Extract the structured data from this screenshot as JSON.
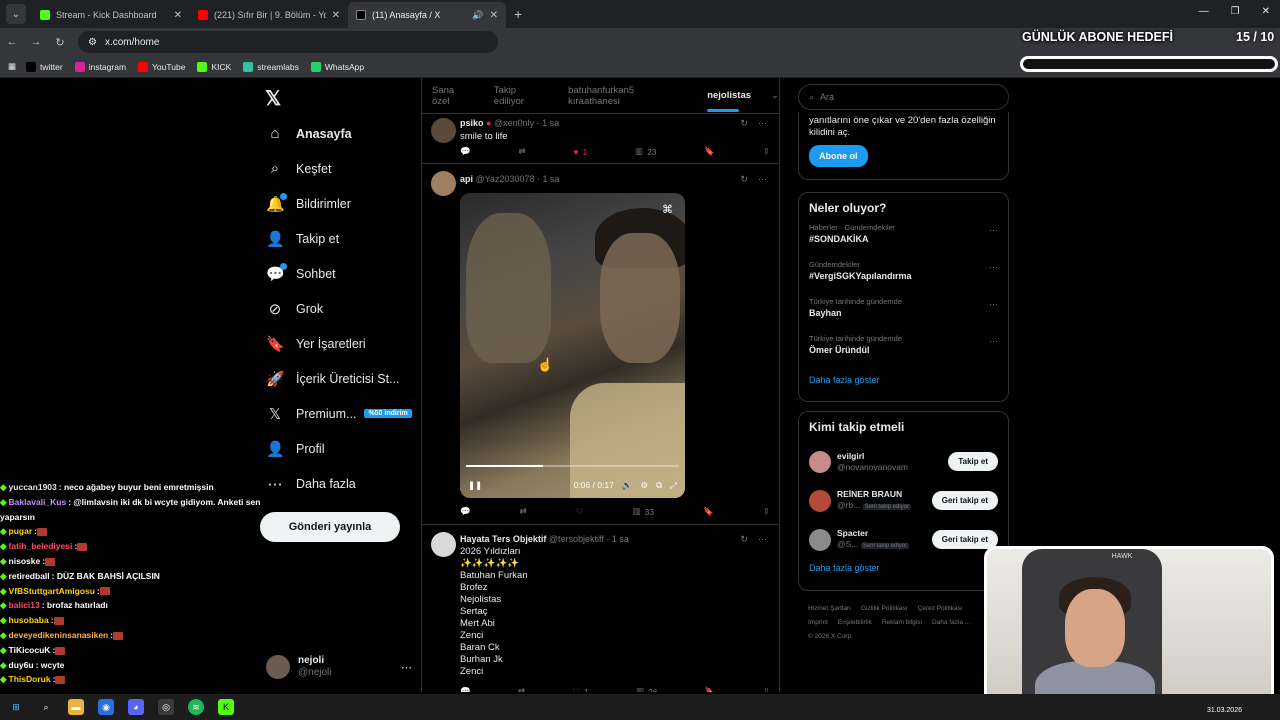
{
  "browser": {
    "tabs": [
      {
        "title": "Stream - Kick Dashboard",
        "color": "#53fc18",
        "active": false
      },
      {
        "title": "(221) Sıfır Bir | 9. Bölüm - YouTu",
        "color": "#ff0000",
        "active": false
      },
      {
        "title": "(11) Anasayfa / X",
        "color": "#000000",
        "active": true
      }
    ],
    "url": "x.com/home",
    "bookmarks": [
      {
        "label": "twitter",
        "icon": "x-icon",
        "color": "#000000"
      },
      {
        "label": "instagram",
        "icon": "instagram-icon",
        "color": "#d6249f"
      },
      {
        "label": "YouTube",
        "icon": "youtube-icon",
        "color": "#ff0000"
      },
      {
        "label": "KICK",
        "icon": "kick-icon",
        "color": "#53fc18"
      },
      {
        "label": "streamlabs",
        "icon": "streamlabs-icon",
        "color": "#31c3a2"
      },
      {
        "label": "WhatsApp",
        "icon": "whatsapp-icon",
        "color": "#25d366"
      }
    ]
  },
  "overlay": {
    "goal_title": "GÜNLÜK ABONE HEDEFİ",
    "goal_count": "15 / 10"
  },
  "nav": {
    "items": [
      {
        "label": "Anasayfa",
        "icon": "home-icon",
        "glyph": "⌂",
        "active": true
      },
      {
        "label": "Keşfet",
        "icon": "search-icon",
        "glyph": "⌕"
      },
      {
        "label": "Bildirimler",
        "icon": "bell-icon",
        "glyph": "🔔",
        "dot": true
      },
      {
        "label": "Takip et",
        "icon": "add-user-icon",
        "glyph": "👤"
      },
      {
        "label": "Sohbet",
        "icon": "chat-icon",
        "glyph": "💬",
        "dot": true
      },
      {
        "label": "Grok",
        "icon": "grok-icon",
        "glyph": "⊘"
      },
      {
        "label": "Yer İşaretleri",
        "icon": "bookmark-icon",
        "glyph": "🔖"
      },
      {
        "label": "İçerik Üreticisi St...",
        "icon": "rocket-icon",
        "glyph": "🚀"
      },
      {
        "label": "Premium...",
        "icon": "x-premium-icon",
        "glyph": "𝕏",
        "badge": "%50 indirim"
      },
      {
        "label": "Profil",
        "icon": "profile-icon",
        "glyph": "👤"
      },
      {
        "label": "Daha fazla",
        "icon": "more-icon",
        "glyph": "⋯"
      }
    ],
    "post_button": "Gönderi yayınla",
    "account": {
      "name": "nejoli",
      "handle": "@nejoli"
    }
  },
  "chat": [
    {
      "user": "yuccan1903",
      "color": "#e6e6e6",
      "msg": ": neco ağabey buyur beni emretmişsin"
    },
    {
      "user": "Baklavali_Kus",
      "color": "#c68cff",
      "msg": ": @limlavsin iki dk bi wcyte gidiyom. Anketi sen"
    },
    {
      "user": "",
      "color": "#ffffff",
      "msg": "yaparsın"
    },
    {
      "user": "pugar",
      "color": "#ffd400",
      "msg": ":"
    },
    {
      "user": "fatih_belediyesi",
      "color": "#ff4d6d",
      "msg": ":"
    },
    {
      "user": "nisoske",
      "color": "#ffffff",
      "msg": ":"
    },
    {
      "user": "retiredball",
      "color": "#ffffff",
      "msg": ": DÜZ BAK BAHSİ AÇILSIN"
    },
    {
      "user": "VfBStuttgartAmigosu",
      "color": "#ffd400",
      "msg": ":"
    },
    {
      "user": "balici13",
      "color": "#ff4d6d",
      "msg": ": brofaz hatırladı"
    },
    {
      "user": "husobaba",
      "color": "#ffd400",
      "msg": ":"
    },
    {
      "user": "deveyedikeninsanasiken",
      "color": "#ffb347",
      "msg": ":"
    },
    {
      "user": "TiKicocuK",
      "color": "#ffffff",
      "msg": ":"
    },
    {
      "user": "duy6u",
      "color": "#ffffff",
      "msg": ": wcyte"
    },
    {
      "user": "ThisDoruk",
      "color": "#ffd400",
      "msg": ":"
    }
  ],
  "timeline": {
    "tabs": [
      "Sana özel",
      "Takip ediliyor",
      "batuhanfurkan5 kıraathanesi",
      "nejolistas"
    ],
    "tweets": [
      {
        "name": "psiko",
        "handle": "@xen0nly · 1 sa",
        "text": "smile to life",
        "reply": "",
        "retweet": "",
        "like": "1",
        "views": "23"
      },
      {
        "name": "api",
        "handle": "@Yaz2030078 · 1 sa",
        "text": "",
        "reply": "",
        "retweet": "",
        "like": "",
        "views": "33",
        "video_time": "0:06 / 0:17",
        "video_progress": 0.36
      },
      {
        "name": "Hayata Ters Objektif",
        "handle": "@tersobjektiff · 1 sa",
        "text": "2026 Yıldızları\n✨✨✨✨✨\nBatuhan Furkan\nBrofez\nNejolistas\nSertaç\nMert Abi\nZenci\nBaran Ck\nBurhan Jk\nZenci",
        "like": "1",
        "views": "26"
      }
    ]
  },
  "sidebar": {
    "search_placeholder": "Ara",
    "premium_text": "yanıtlarını öne çıkar ve 20'den fazla özelliğin kilidini aç.",
    "subscribe": "Abone ol",
    "trends_title": "Neler oluyor?",
    "trends": [
      {
        "context": "Haberler · Gündemdekiler",
        "name": "#SONDAKİKA"
      },
      {
        "context": "Gündemdekiler",
        "name": "#VergiSGKYapılandırma"
      },
      {
        "context": "Türkiye tarihinde gündemde",
        "name": "Bayhan"
      },
      {
        "context": "Türkiye tarihinde gündemde",
        "name": "Ömer Üründül"
      }
    ],
    "show_more": "Daha fazla göster",
    "who_title": "Kimi takip etmeli",
    "who": [
      {
        "name": "evilgirl",
        "handle": "@novanovanovam",
        "tag": "",
        "button": "Takip et",
        "color": "#c78a8a"
      },
      {
        "name": "REİNER BRAUN",
        "handle": "@rb...",
        "tag": "Seni takip ediyor",
        "button": "Geri takip et",
        "color": "#b34a3c"
      },
      {
        "name": "Spacter",
        "handle": "@S...",
        "tag": "Seni takip ediyor",
        "button": "Geri takip et",
        "color": "#8a8a8a"
      }
    ],
    "footer": [
      "Hizmet Şartları",
      "Gizlilik Politikası",
      "Çerez Politikası",
      "Imprint",
      "Erişilebilirlik",
      "Reklam bilgisi",
      "Daha fazla ...",
      "© 2026 X Corp."
    ]
  },
  "taskbar": {
    "date": "31.03.2026"
  }
}
